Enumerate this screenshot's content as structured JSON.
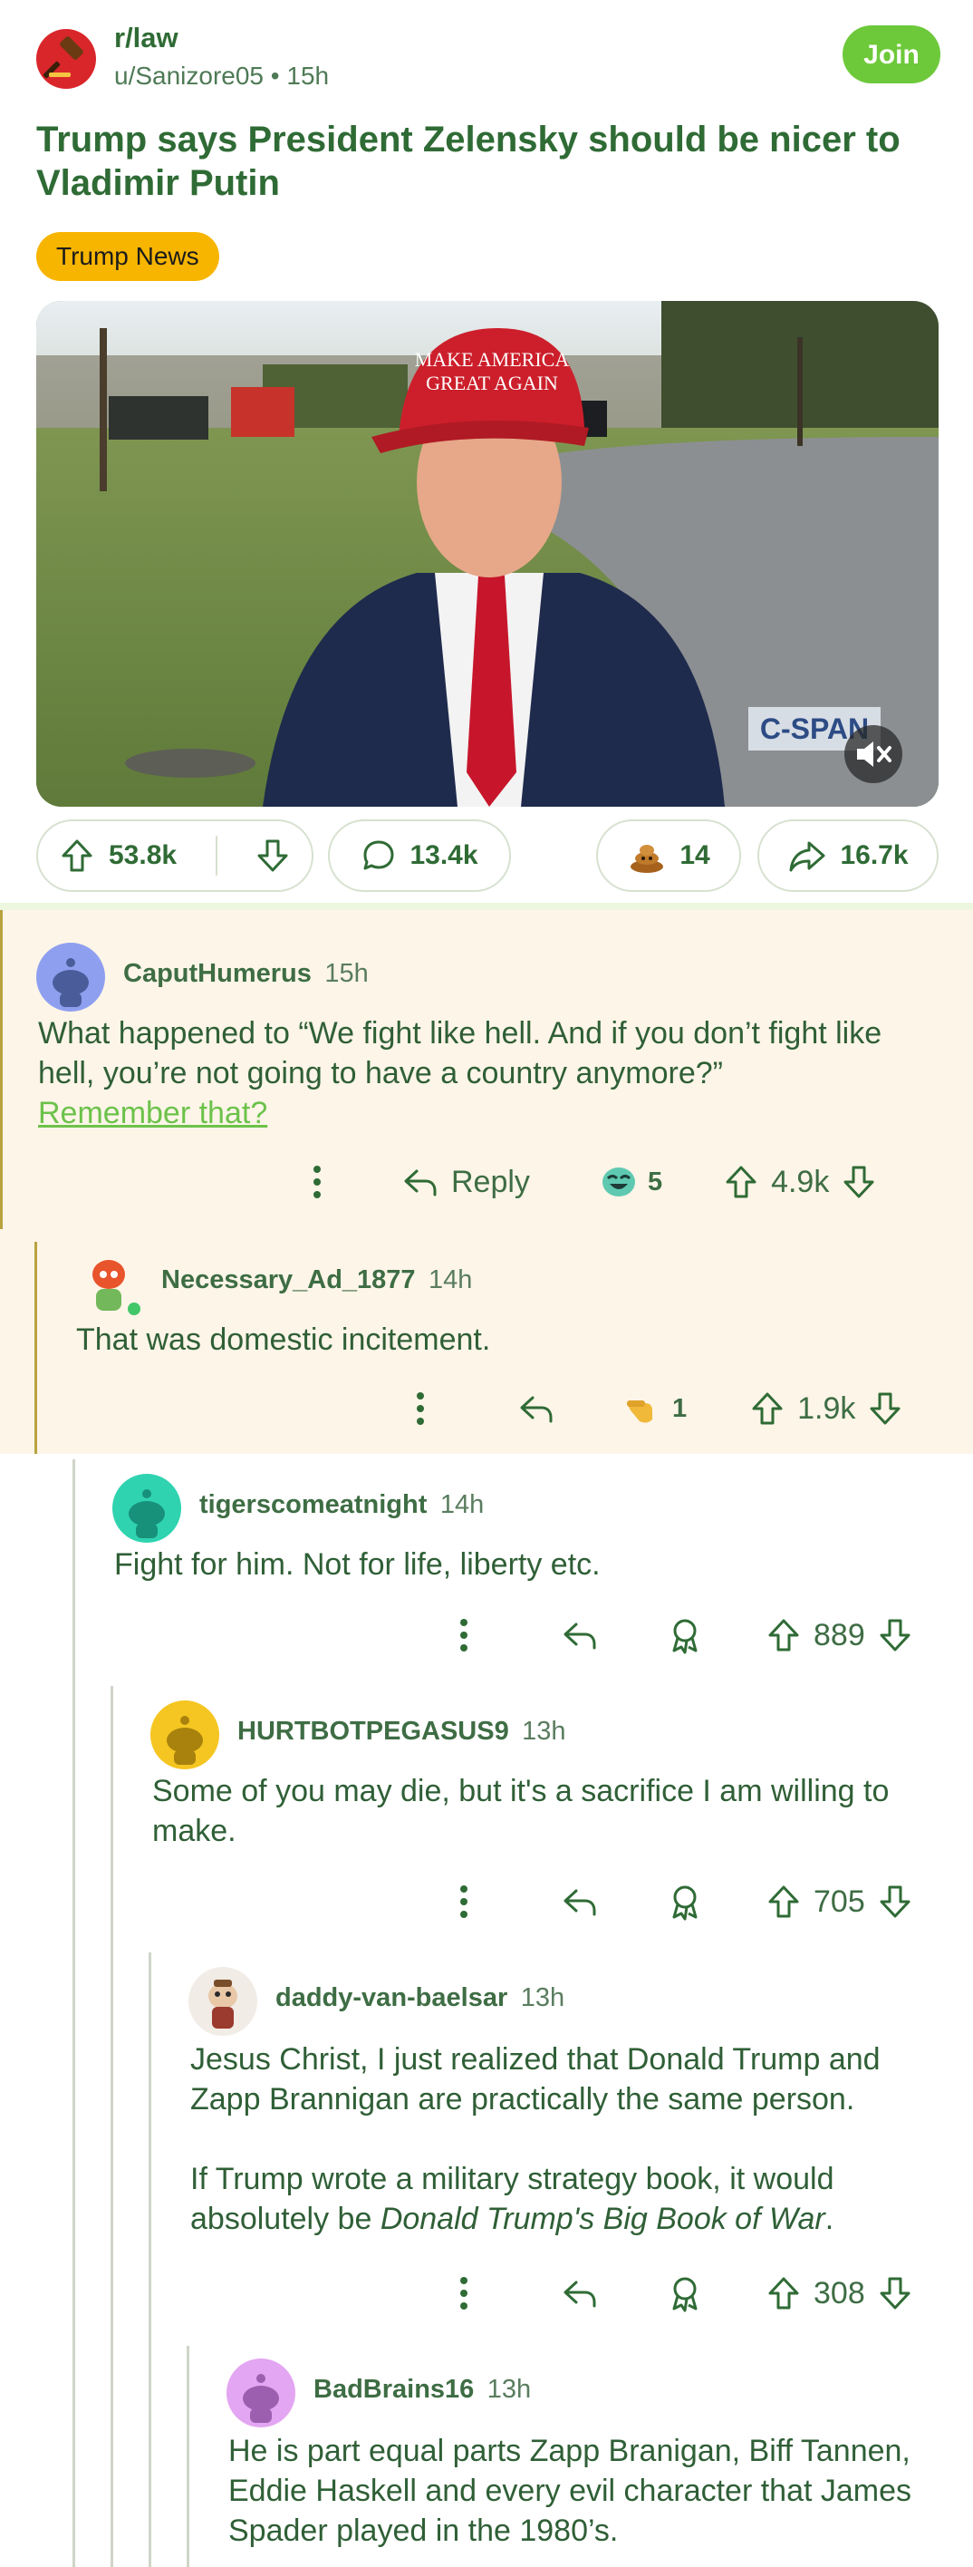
{
  "post": {
    "subreddit": "r/law",
    "author": "u/Sanizore05",
    "age": "15h",
    "join_label": "Join",
    "title": "Trump says President Zelensky should be nicer to Vladimir Putin",
    "flair": "Trump News",
    "media": {
      "hat_line1": "MAKE AMERICA",
      "hat_line2": "GREAT AGAIN",
      "watermark": "C-SPAN"
    },
    "upvotes": "53.8k",
    "comments": "13.4k",
    "awards": "14",
    "shares": "16.7k"
  },
  "comments": [
    {
      "user": "CaputHumerus",
      "time": "15h",
      "body": "What happened to “We fight like hell. And if you don’t fight like hell, you’re not going to have a country anymore?”",
      "link": "Remember that?",
      "reply_label": "Reply",
      "award_count": "5",
      "score": "4.9k"
    },
    {
      "user": "Necessary_Ad_1877",
      "time": "14h",
      "body": "That was domestic incitement.",
      "award_count": "1",
      "score": "1.9k"
    },
    {
      "user": "tigerscomeatnight",
      "time": "14h",
      "body": "Fight for him. Not for life, liberty etc.",
      "score": "889"
    },
    {
      "user": "HURTBOTPEGASUS9",
      "time": "13h",
      "body": "Some of you may die, but it's a sacrifice I am willing to make.",
      "score": "705"
    },
    {
      "user": "daddy-van-baelsar",
      "time": "13h",
      "body1": "Jesus Christ, I just realized that Donald Trump and Zapp Brannigan are practically the same person.",
      "body2_prefix": "If Trump wrote a military strategy book, it would absolutely be ",
      "body2_italic": "Donald Trump's Big Book of War",
      "body2_suffix": ".",
      "score": "308"
    },
    {
      "user": "BadBrains16",
      "time": "13h",
      "body": "He is part equal parts Zapp Branigan, Biff Tannen, Eddie Haskell and every evil character that James Spader played in the 1980’s."
    }
  ]
}
